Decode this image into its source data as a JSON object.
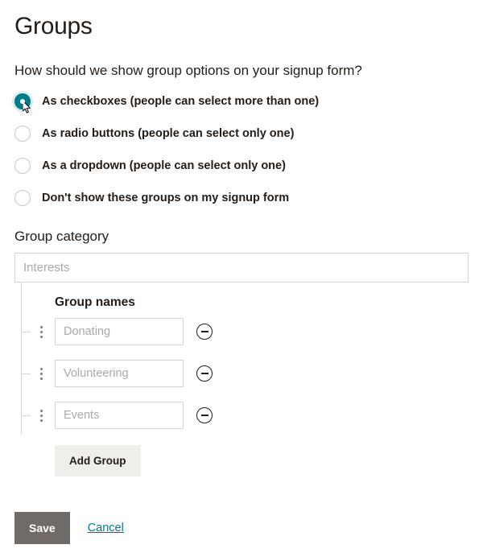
{
  "title": "Groups",
  "question": "How should we show group options on your signup form?",
  "display_options": [
    {
      "label": "As checkboxes (people can select more than one)",
      "selected": true
    },
    {
      "label": "As radio buttons (people can select only one)",
      "selected": false
    },
    {
      "label": "As a dropdown (people can select only one)",
      "selected": false
    },
    {
      "label": "Don't show these groups on my signup form",
      "selected": false
    }
  ],
  "category": {
    "label": "Group category",
    "placeholder": "Interests"
  },
  "group_names": {
    "label": "Group names",
    "items": [
      {
        "placeholder": "Donating"
      },
      {
        "placeholder": "Volunteering"
      },
      {
        "placeholder": "Events"
      }
    ],
    "add_label": "Add Group"
  },
  "footer": {
    "save": "Save",
    "cancel": "Cancel"
  }
}
